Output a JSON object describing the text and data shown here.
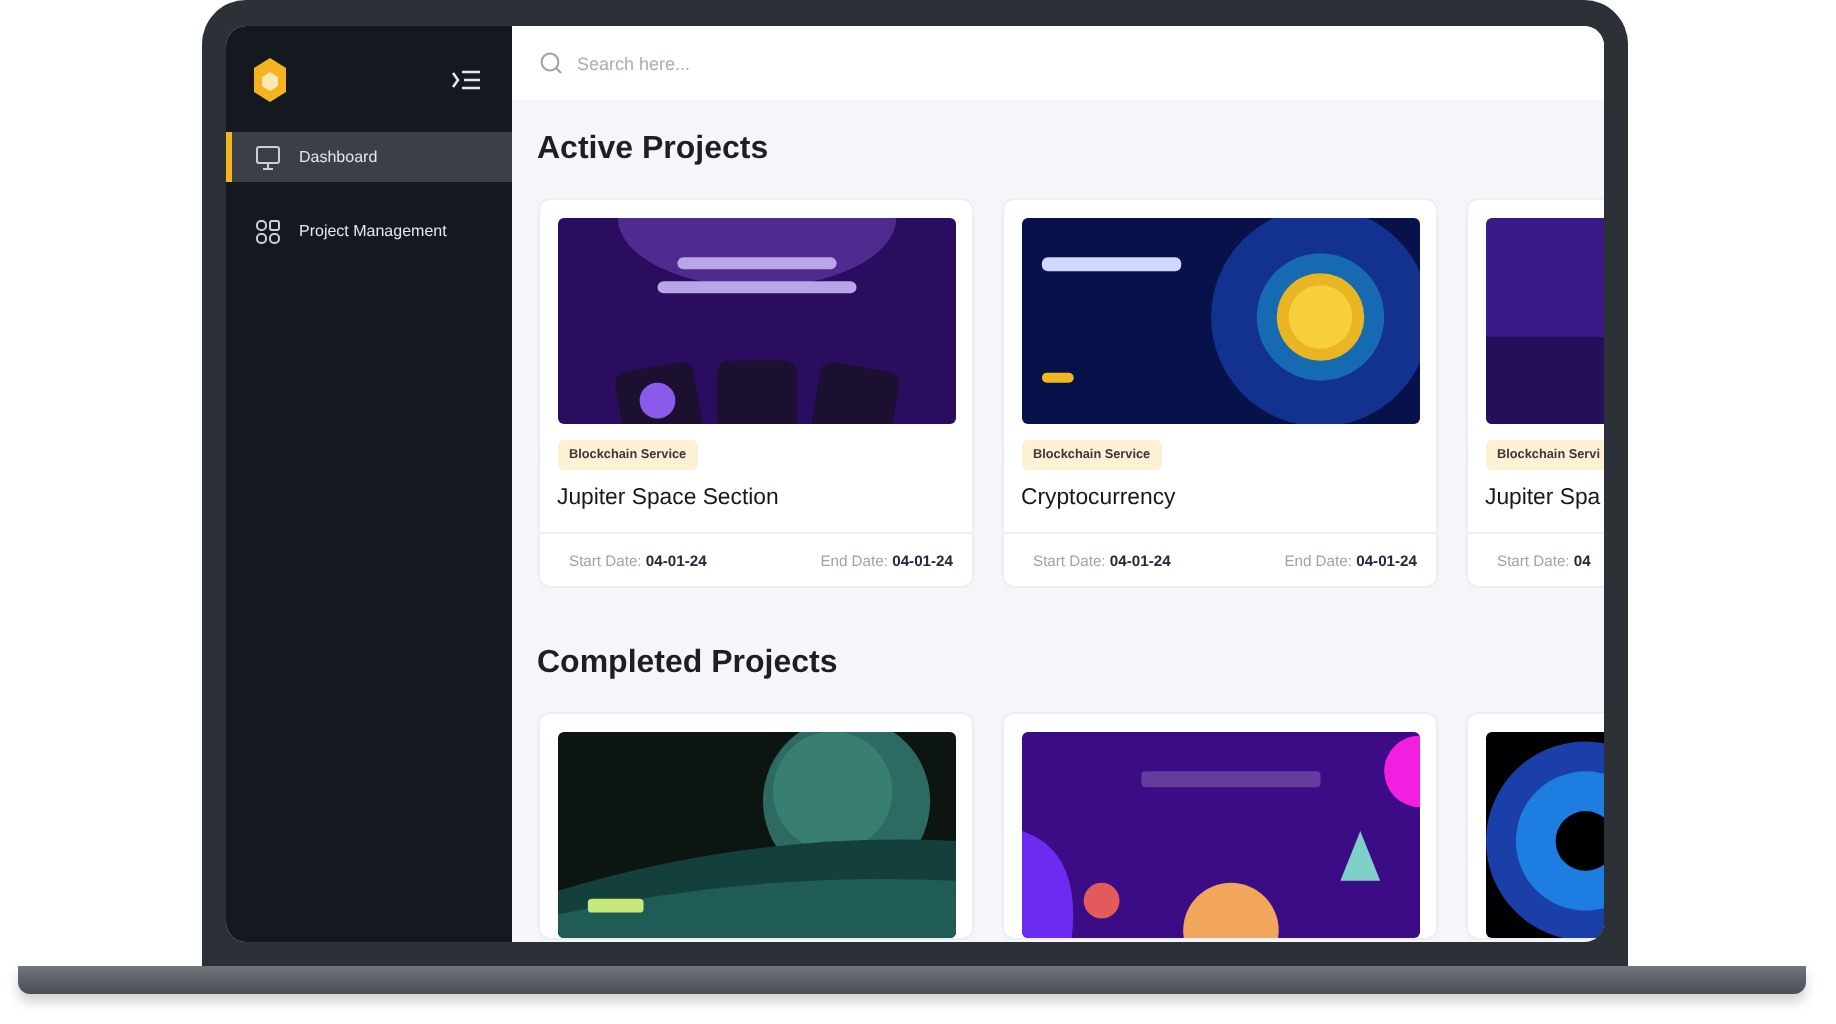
{
  "sidebar": {
    "items": [
      {
        "label": "Dashboard",
        "selected": true
      },
      {
        "label": "Project Management",
        "selected": false
      }
    ]
  },
  "search": {
    "placeholder": "Search here..."
  },
  "sections": [
    {
      "title": "Active Projects",
      "cards": [
        {
          "tag": "Blockchain Service",
          "title": "Jupiter Space Section",
          "start_label": "Start Date:",
          "start": "04-01-24",
          "end_label": "End Date:",
          "end": "04-01-24"
        },
        {
          "tag": "Blockchain Service",
          "title": "Cryptocurrency",
          "start_label": "Start Date:",
          "start": "04-01-24",
          "end_label": "End Date:",
          "end": "04-01-24"
        },
        {
          "tag": "Blockchain Servi",
          "title": "Jupiter Spa",
          "start_label": "Start Date:",
          "start": "04"
        }
      ]
    },
    {
      "title": "Completed Projects"
    }
  ]
}
